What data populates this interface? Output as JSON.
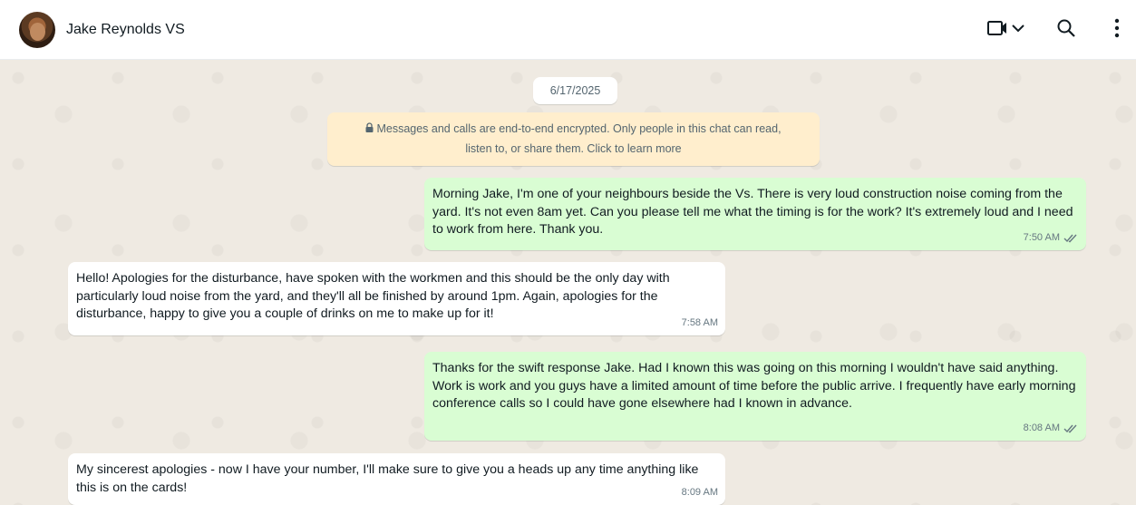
{
  "header": {
    "contact_name": "Jake Reynolds VS",
    "icons": [
      "video-call-icon",
      "chevron-down-icon",
      "search-icon",
      "more-menu-icon"
    ]
  },
  "chat": {
    "date": "6/17/2025",
    "encryption_notice_line1": "Messages and calls are end-to-end encrypted. Only people in this chat can read,",
    "encryption_notice_line2": "listen to, or share them. Click to learn more",
    "messages": [
      {
        "direction": "outgoing",
        "text": "Morning Jake, I'm one of your neighbours beside the Vs. There is very loud construction noise coming from the yard. It's not even 8am yet. Can you please tell me what the timing is for the work? It's extremely loud and I need to work from here. Thank you.",
        "time": "7:50 AM",
        "status": "read"
      },
      {
        "direction": "incoming",
        "text": "Hello! Apologies for the disturbance, have spoken with the workmen and this should be the only day with particularly loud noise from the yard, and they'll all be finished by around 1pm. Again, apologies for the disturbance, happy to give you a couple of drinks on me to make up for it!",
        "time": "7:58 AM"
      },
      {
        "direction": "outgoing",
        "text": "Thanks for the swift response Jake. Had I known this was going on this morning I wouldn't have said anything. Work is work and you guys have a limited amount of time before the public arrive. I frequently have early morning conference calls so I could have gone elsewhere had I known in advance.",
        "time": "8:08 AM",
        "status": "read"
      },
      {
        "direction": "incoming",
        "text": "My sincerest apologies - now I have your number, I'll make sure to give you a heads up any time anything like this is on the cards!",
        "time": "8:09 AM"
      }
    ]
  },
  "colors": {
    "outgoing_bubble": "#d9fdd3",
    "incoming_bubble": "#ffffff",
    "chat_background": "#efeae2",
    "encryption_banner": "#ffeecd"
  }
}
